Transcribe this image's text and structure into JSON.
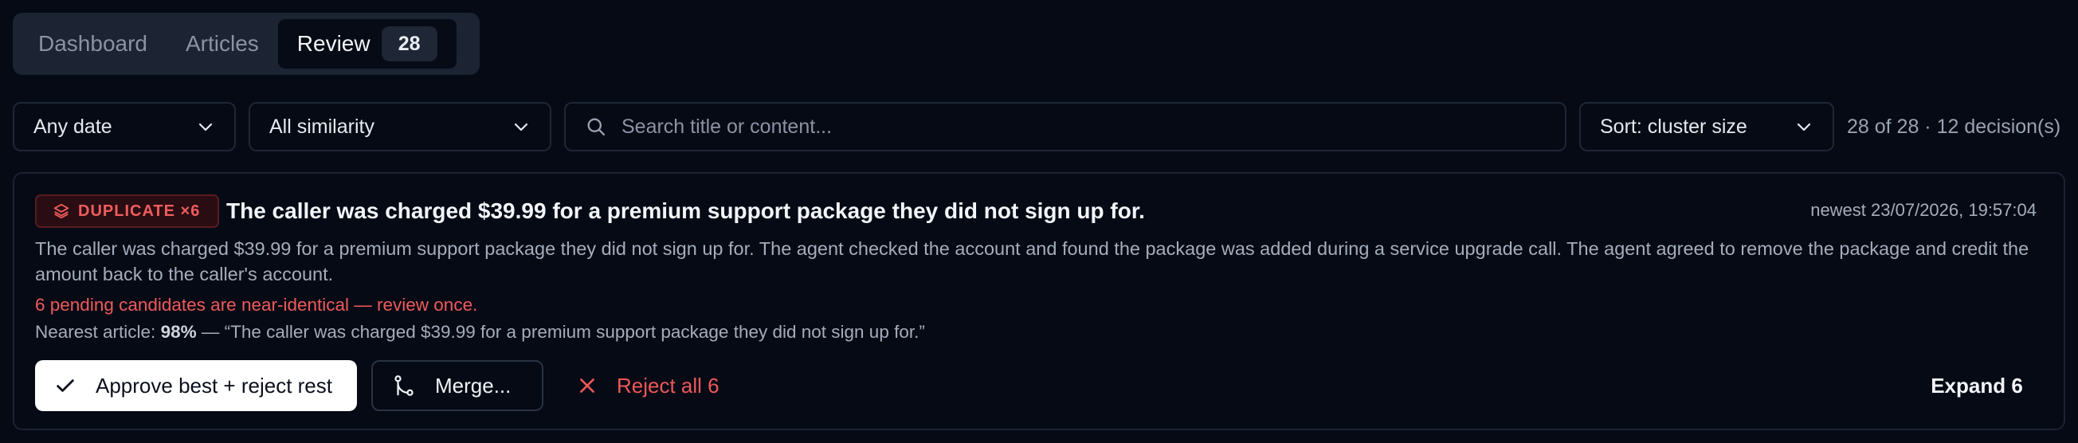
{
  "tabs": [
    {
      "label": "Dashboard",
      "active": false
    },
    {
      "label": "Articles",
      "active": false
    },
    {
      "label": "Review",
      "active": true,
      "count": "28"
    }
  ],
  "filters": {
    "date": "Any date",
    "similarity": "All similarity",
    "search_placeholder": "Search title or content...",
    "sort": "Sort: cluster size",
    "result_count": "28 of 28 · 12 decision(s)"
  },
  "card": {
    "badge": "DUPLICATE ×6",
    "title": "The caller was charged $39.99 for a premium support package they did not sign up for.",
    "timestamp": "newest 23/07/2026, 19:57:04",
    "content": "The caller was charged $39.99 for a premium support package they did not sign up for. The agent checked the account and found the package was added during a service upgrade call. The agent agreed to remove the package and credit the amount back to the caller's account.",
    "warning": "6 pending candidates are near-identical — review once.",
    "nearest_prefix": "Nearest article: ",
    "nearest_score": "98%",
    "nearest_text": " — “The caller was charged $39.99 for a premium support package they did not sign up for.”",
    "actions": {
      "approve": "Approve best + reject rest",
      "merge": "Merge...",
      "reject": "Reject all 6",
      "expand": "Expand 6"
    }
  },
  "colors": {
    "background": "#050a15",
    "danger": "#ef5a5a",
    "border": "#1f2636"
  }
}
